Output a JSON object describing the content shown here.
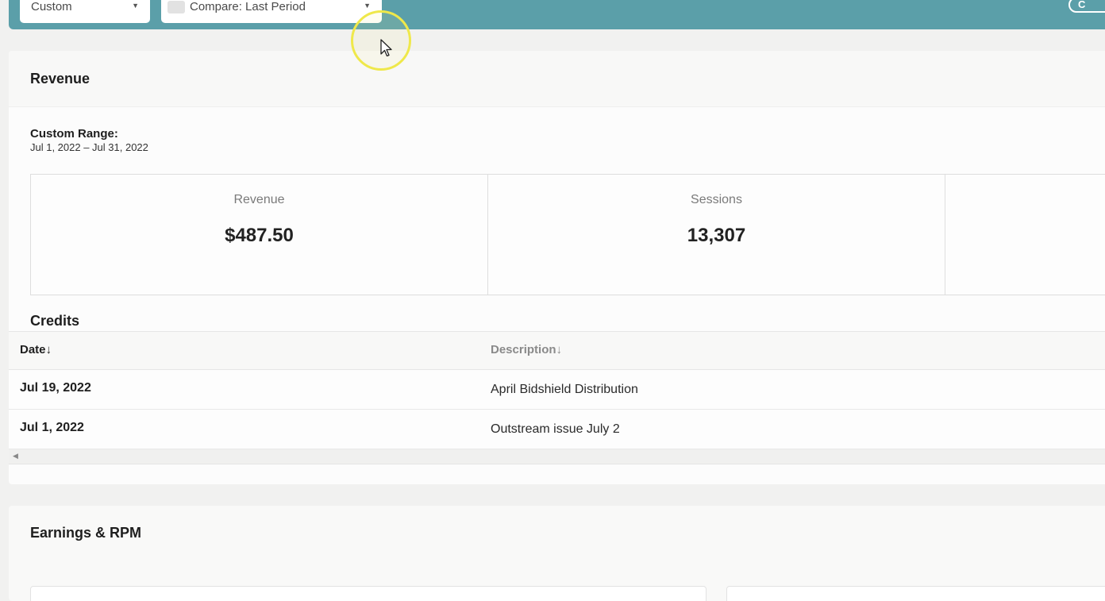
{
  "filters": {
    "range_select": "Custom",
    "compare_select": "Compare: Last Period",
    "action_button": "C"
  },
  "revenue_card": {
    "title": "Revenue",
    "range_label": "Custom Range:",
    "range_value": "Jul 1, 2022 – Jul 31, 2022",
    "metrics": [
      {
        "label": "Revenue",
        "value": "$487.50"
      },
      {
        "label": "Sessions",
        "value": "13,307"
      },
      {
        "label": "",
        "value": ""
      }
    ]
  },
  "credits": {
    "title": "Credits",
    "columns": [
      "Date↓",
      "Description↓"
    ],
    "rows": [
      {
        "date": "Jul 19, 2022",
        "description": "April Bidshield Distribution"
      },
      {
        "date": "Jul 1, 2022",
        "description": "Outstream issue July 2"
      }
    ]
  },
  "earnings_card": {
    "title": "Earnings & RPM"
  },
  "icons": {
    "dropdown_caret": "chevron-down-icon",
    "scroll_left": "scroll-left-arrow-icon",
    "cursor": "mouse-pointer-icon"
  },
  "colors": {
    "topbar": "#5b9fa9",
    "cursor_highlight": "#efe84a"
  }
}
